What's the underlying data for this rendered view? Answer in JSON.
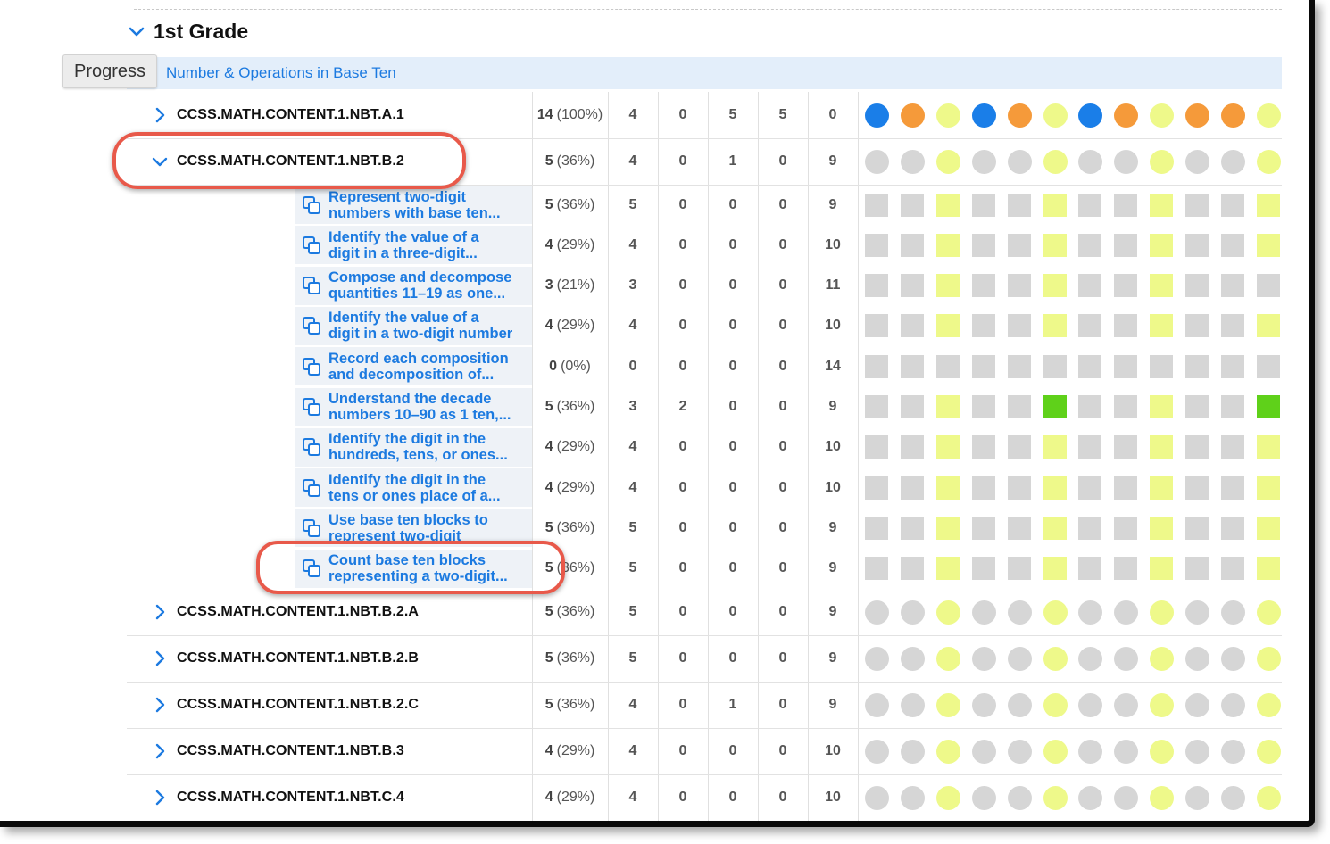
{
  "grade": {
    "title": "1st Grade"
  },
  "tooltip": "Progress",
  "domain": {
    "label": "Number & Operations in Base Ten"
  },
  "colors": {
    "mastered": "#1a7ee8",
    "practiced": "#f59a3a",
    "attempted": "#eef98a",
    "not_started": "#d6d6d6",
    "highlight_green": "#5fd11a",
    "link_blue": "#1c7ae0",
    "annotation_red": "#e8594a"
  },
  "standards_before": [
    {
      "code": "CCSS.MATH.CONTENT.1.NBT.A.1",
      "expanded": false,
      "score": "14",
      "pct": "(100%)",
      "c1": "4",
      "c2": "0",
      "c3": "5",
      "c4": "5",
      "c5": "0",
      "dots": [
        "b",
        "o",
        "y",
        "b",
        "o",
        "y",
        "b",
        "o",
        "y",
        "o",
        "o",
        "y"
      ]
    },
    {
      "code": "CCSS.MATH.CONTENT.1.NBT.B.2",
      "expanded": true,
      "score": "5",
      "pct": "(36%)",
      "c1": "4",
      "c2": "0",
      "c3": "1",
      "c4": "0",
      "c5": "9",
      "dots": [
        "g",
        "g",
        "y",
        "g",
        "g",
        "y",
        "g",
        "g",
        "y",
        "g",
        "g",
        "y"
      ]
    }
  ],
  "skills": [
    {
      "line1": "Represent two-digit",
      "line2": "numbers with base ten...",
      "score": "5",
      "pct": "(36%)",
      "c1": "5",
      "c2": "0",
      "c3": "0",
      "c4": "0",
      "c5": "9",
      "squares": [
        "g",
        "g",
        "y",
        "g",
        "g",
        "y",
        "g",
        "g",
        "y",
        "g",
        "g",
        "y"
      ]
    },
    {
      "line1": "Identify the value of a",
      "line2": "digit in a three-digit...",
      "score": "4",
      "pct": "(29%)",
      "c1": "4",
      "c2": "0",
      "c3": "0",
      "c4": "0",
      "c5": "10",
      "squares": [
        "g",
        "g",
        "y",
        "g",
        "g",
        "y",
        "g",
        "g",
        "y",
        "g",
        "g",
        "y"
      ]
    },
    {
      "line1": "Compose and decompose",
      "line2": "quantities 11–19 as one...",
      "score": "3",
      "pct": "(21%)",
      "c1": "3",
      "c2": "0",
      "c3": "0",
      "c4": "0",
      "c5": "11",
      "squares": [
        "g",
        "g",
        "y",
        "g",
        "g",
        "y",
        "g",
        "g",
        "y",
        "g",
        "g",
        "g"
      ]
    },
    {
      "line1": "Identify the value of a",
      "line2": "digit in a two-digit number",
      "score": "4",
      "pct": "(29%)",
      "c1": "4",
      "c2": "0",
      "c3": "0",
      "c4": "0",
      "c5": "10",
      "squares": [
        "g",
        "g",
        "y",
        "g",
        "g",
        "y",
        "g",
        "g",
        "y",
        "g",
        "g",
        "y"
      ]
    },
    {
      "line1": "Record each composition",
      "line2": "and decomposition of...",
      "score": "0",
      "pct": "(0%)",
      "c1": "0",
      "c2": "0",
      "c3": "0",
      "c4": "0",
      "c5": "14",
      "squares": [
        "g",
        "g",
        "g",
        "g",
        "g",
        "g",
        "g",
        "g",
        "g",
        "g",
        "g",
        "g"
      ]
    },
    {
      "line1": "Understand the decade",
      "line2": "numbers 10–90 as 1 ten,...",
      "score": "5",
      "pct": "(36%)",
      "c1": "3",
      "c2": "2",
      "c3": "0",
      "c4": "0",
      "c5": "9",
      "squares": [
        "g",
        "g",
        "y",
        "g",
        "g",
        "G",
        "g",
        "g",
        "y",
        "g",
        "g",
        "G"
      ]
    },
    {
      "line1": "Identify the digit in the",
      "line2": "hundreds, tens, or ones...",
      "score": "4",
      "pct": "(29%)",
      "c1": "4",
      "c2": "0",
      "c3": "0",
      "c4": "0",
      "c5": "10",
      "squares": [
        "g",
        "g",
        "y",
        "g",
        "g",
        "y",
        "g",
        "g",
        "y",
        "g",
        "g",
        "y"
      ]
    },
    {
      "line1": "Identify the digit in the",
      "line2": "tens or ones place of a...",
      "score": "4",
      "pct": "(29%)",
      "c1": "4",
      "c2": "0",
      "c3": "0",
      "c4": "0",
      "c5": "10",
      "squares": [
        "g",
        "g",
        "y",
        "g",
        "g",
        "y",
        "g",
        "g",
        "y",
        "g",
        "g",
        "y"
      ]
    },
    {
      "line1": "Use base ten blocks to",
      "line2": "represent two-digit",
      "score": "5",
      "pct": "(36%)",
      "c1": "5",
      "c2": "0",
      "c3": "0",
      "c4": "0",
      "c5": "9",
      "squares": [
        "g",
        "g",
        "y",
        "g",
        "g",
        "y",
        "g",
        "g",
        "y",
        "g",
        "g",
        "y"
      ]
    },
    {
      "line1": "Count base ten blocks",
      "line2": "representing a two-digit...",
      "score": "5",
      "pct": "(36%)",
      "c1": "5",
      "c2": "0",
      "c3": "0",
      "c4": "0",
      "c5": "9",
      "squares": [
        "g",
        "g",
        "y",
        "g",
        "g",
        "y",
        "g",
        "g",
        "y",
        "g",
        "g",
        "y"
      ]
    }
  ],
  "standards_after": [
    {
      "code": "CCSS.MATH.CONTENT.1.NBT.B.2.A",
      "expanded": false,
      "score": "5",
      "pct": "(36%)",
      "c1": "5",
      "c2": "0",
      "c3": "0",
      "c4": "0",
      "c5": "9",
      "dots": [
        "g",
        "g",
        "y",
        "g",
        "g",
        "y",
        "g",
        "g",
        "y",
        "g",
        "g",
        "y"
      ]
    },
    {
      "code": "CCSS.MATH.CONTENT.1.NBT.B.2.B",
      "expanded": false,
      "score": "5",
      "pct": "(36%)",
      "c1": "5",
      "c2": "0",
      "c3": "0",
      "c4": "0",
      "c5": "9",
      "dots": [
        "g",
        "g",
        "y",
        "g",
        "g",
        "y",
        "g",
        "g",
        "y",
        "g",
        "g",
        "y"
      ]
    },
    {
      "code": "CCSS.MATH.CONTENT.1.NBT.B.2.C",
      "expanded": false,
      "score": "5",
      "pct": "(36%)",
      "c1": "4",
      "c2": "0",
      "c3": "1",
      "c4": "0",
      "c5": "9",
      "dots": [
        "g",
        "g",
        "y",
        "g",
        "g",
        "y",
        "g",
        "g",
        "y",
        "g",
        "g",
        "y"
      ]
    },
    {
      "code": "CCSS.MATH.CONTENT.1.NBT.B.3",
      "expanded": false,
      "score": "4",
      "pct": "(29%)",
      "c1": "4",
      "c2": "0",
      "c3": "0",
      "c4": "0",
      "c5": "10",
      "dots": [
        "g",
        "g",
        "y",
        "g",
        "g",
        "y",
        "g",
        "g",
        "y",
        "g",
        "g",
        "y"
      ]
    },
    {
      "code": "CCSS.MATH.CONTENT.1.NBT.C.4",
      "expanded": false,
      "score": "4",
      "pct": "(29%)",
      "c1": "4",
      "c2": "0",
      "c3": "0",
      "c4": "0",
      "c5": "10",
      "dots": [
        "g",
        "g",
        "y",
        "g",
        "g",
        "y",
        "g",
        "g",
        "y",
        "g",
        "g",
        "y"
      ]
    }
  ]
}
